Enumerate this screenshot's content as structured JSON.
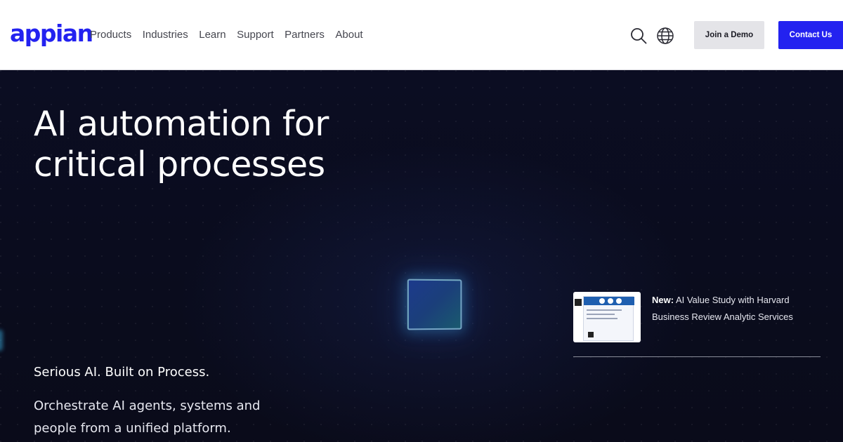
{
  "header": {
    "logo_text": "appian",
    "nav": [
      "Products",
      "Industries",
      "Learn",
      "Support",
      "Partners",
      "About"
    ],
    "search_icon": "search-icon",
    "language_icon": "globe-icon",
    "join_demo_label": "Join a Demo",
    "contact_label": "Contact Us",
    "brand_color": "#2322f0"
  },
  "hero": {
    "title_line1": "AI automation for",
    "title_line2": "critical processes",
    "tagline": "Serious AI. Built on Process.",
    "subtext": "Orchestrate AI agents, systems and people from a unified platform."
  },
  "promo": {
    "badge": "New:",
    "text": " AI Value Study with Harvard Business Review Analytic Services"
  }
}
